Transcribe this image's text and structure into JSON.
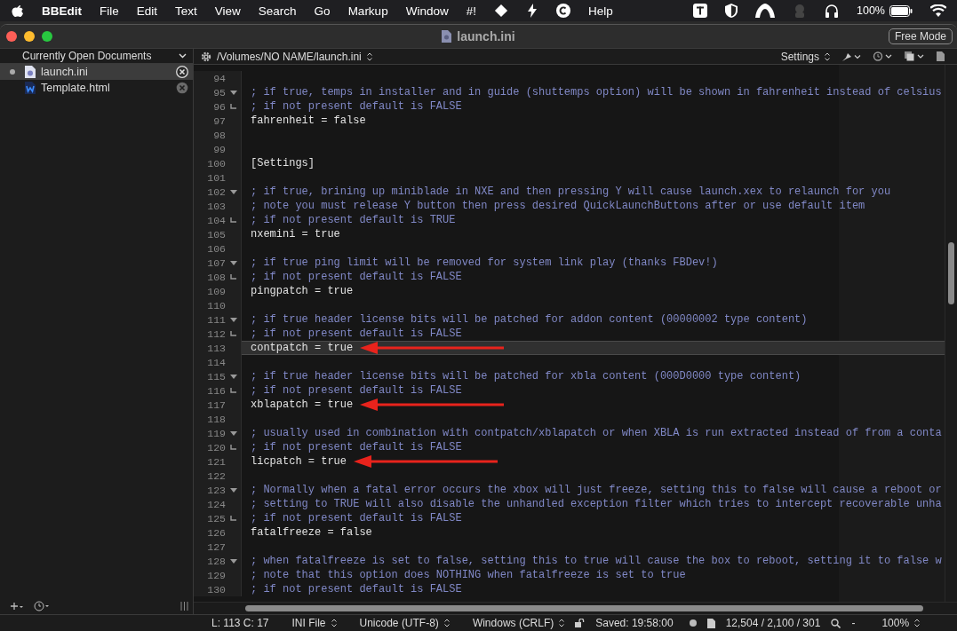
{
  "menu_bar": {
    "app_name": "BBEdit",
    "menus": [
      "File",
      "Edit",
      "Text",
      "View",
      "Search",
      "Go",
      "Markup",
      "Window",
      "#!"
    ],
    "menus_after_icons": [
      "Help"
    ],
    "battery": "100%"
  },
  "window": {
    "title": "launch.ini",
    "free_mode_button": "Free Mode"
  },
  "sidebar": {
    "header": "Currently Open Documents",
    "documents": [
      {
        "name": "launch.ini",
        "kind": "ini",
        "selected": true,
        "modified": true
      },
      {
        "name": "Template.html",
        "kind": "html",
        "selected": false,
        "modified": false
      }
    ]
  },
  "editor": {
    "path": "/Volumes/NO NAME/launch.ini",
    "settings_label": "Settings",
    "lines": [
      {
        "number": "94",
        "selected": false,
        "arrow": false
      },
      {
        "number": "95",
        "fold_start": true,
        "kind": "comment",
        "text": "; if true, temps in installer and in guide (shuttemps option) will be shown in fahrenheit instead of celsius",
        "selected": false,
        "arrow": false
      },
      {
        "number": "96",
        "fold_end": true,
        "kind": "comment",
        "text": "; if not present default is FALSE",
        "selected": false,
        "arrow": false
      },
      {
        "number": "97",
        "kind": "code",
        "text": "fahrenheit = false",
        "selected": false,
        "arrow": false
      },
      {
        "number": "98",
        "selected": false,
        "arrow": false
      },
      {
        "number": "99",
        "selected": false,
        "arrow": false
      },
      {
        "number": "100",
        "kind": "code",
        "text": "[Settings]",
        "selected": false,
        "arrow": false
      },
      {
        "number": "101",
        "selected": false,
        "arrow": false
      },
      {
        "number": "102",
        "fold_start": true,
        "kind": "comment",
        "text": "; if true, brining up miniblade in NXE and then pressing Y will cause launch.xex to relaunch for you",
        "selected": false,
        "arrow": false
      },
      {
        "number": "103",
        "kind": "comment",
        "text": "; note you must release Y button then press desired QuickLaunchButtons after or use default item",
        "selected": false,
        "arrow": false
      },
      {
        "number": "104",
        "fold_end": true,
        "kind": "comment",
        "text": "; if not present default is TRUE",
        "selected": false,
        "arrow": false
      },
      {
        "number": "105",
        "kind": "code",
        "text": "nxemini = true",
        "selected": false,
        "arrow": false
      },
      {
        "number": "106",
        "selected": false,
        "arrow": false
      },
      {
        "number": "107",
        "fold_start": true,
        "kind": "comment",
        "text": "; if true ping limit will be removed for system link play (thanks FBDev!)",
        "selected": false,
        "arrow": false
      },
      {
        "number": "108",
        "fold_end": true,
        "kind": "comment",
        "text": "; if not present default is FALSE",
        "selected": false,
        "arrow": false
      },
      {
        "number": "109",
        "kind": "code",
        "text": "pingpatch = true",
        "selected": false,
        "arrow": false
      },
      {
        "number": "110",
        "selected": false,
        "arrow": false
      },
      {
        "number": "111",
        "fold_start": true,
        "kind": "comment",
        "text": "; if true header license bits will be patched for addon content (00000002 type content)",
        "selected": false,
        "arrow": false
      },
      {
        "number": "112",
        "fold_end": true,
        "kind": "comment",
        "text": "; if not present default is FALSE",
        "selected": false,
        "arrow": false
      },
      {
        "number": "113",
        "kind": "code",
        "text": "contpatch = true",
        "selected": true,
        "arrow": true
      },
      {
        "number": "114",
        "selected": false,
        "arrow": false
      },
      {
        "number": "115",
        "fold_start": true,
        "kind": "comment",
        "text": "; if true header license bits will be patched for xbla content (000D0000 type content)",
        "selected": false,
        "arrow": false
      },
      {
        "number": "116",
        "fold_end": true,
        "kind": "comment",
        "text": "; if not present default is FALSE",
        "selected": false,
        "arrow": false
      },
      {
        "number": "117",
        "kind": "code",
        "text": "xblapatch = true",
        "selected": false,
        "arrow": true
      },
      {
        "number": "118",
        "selected": false,
        "arrow": false
      },
      {
        "number": "119",
        "fold_start": true,
        "kind": "comment",
        "text": "; usually used in combination with contpatch/xblapatch or when XBLA is run extracted instead of from a conta",
        "selected": false,
        "arrow": false
      },
      {
        "number": "120",
        "fold_end": true,
        "kind": "comment",
        "text": "; if not present default is FALSE",
        "selected": false,
        "arrow": false
      },
      {
        "number": "121",
        "kind": "code",
        "text": "licpatch = true",
        "selected": false,
        "arrow": true
      },
      {
        "number": "122",
        "selected": false,
        "arrow": false
      },
      {
        "number": "123",
        "fold_start": true,
        "kind": "comment",
        "text": "; Normally when a fatal error occurs the xbox will just freeze, setting this to false will cause a reboot or",
        "selected": false,
        "arrow": false
      },
      {
        "number": "124",
        "kind": "comment",
        "text": "; setting to TRUE will also disable the unhandled exception filter which tries to intercept recoverable unha",
        "selected": false,
        "arrow": false
      },
      {
        "number": "125",
        "fold_end": true,
        "kind": "comment",
        "text": "; if not present default is FALSE",
        "selected": false,
        "arrow": false
      },
      {
        "number": "126",
        "kind": "code",
        "text": "fatalfreeze = false",
        "selected": false,
        "arrow": false
      },
      {
        "number": "127",
        "selected": false,
        "arrow": false
      },
      {
        "number": "128",
        "fold_start": true,
        "kind": "comment",
        "text": "; when fatalfreeze is set to false, setting this to true will cause the box to reboot, setting it to false w",
        "selected": false,
        "arrow": false
      },
      {
        "number": "129",
        "kind": "comment",
        "text": "; note that this option does NOTHING when fatalfreeze is set to true",
        "selected": false,
        "arrow": false
      },
      {
        "number": "130",
        "kind": "comment",
        "text": "; if not present default is FALSE",
        "selected": false,
        "arrow": false
      }
    ]
  },
  "status_bar": {
    "position": "L: 113 C: 17",
    "language": "INI File",
    "encoding": "Unicode (UTF-8)",
    "line_endings": "Windows (CRLF)",
    "saved": "Saved: 19:58:00",
    "counts": "12,504 / 2,100 / 301",
    "zoom_out": "-",
    "zoom": "100%"
  }
}
